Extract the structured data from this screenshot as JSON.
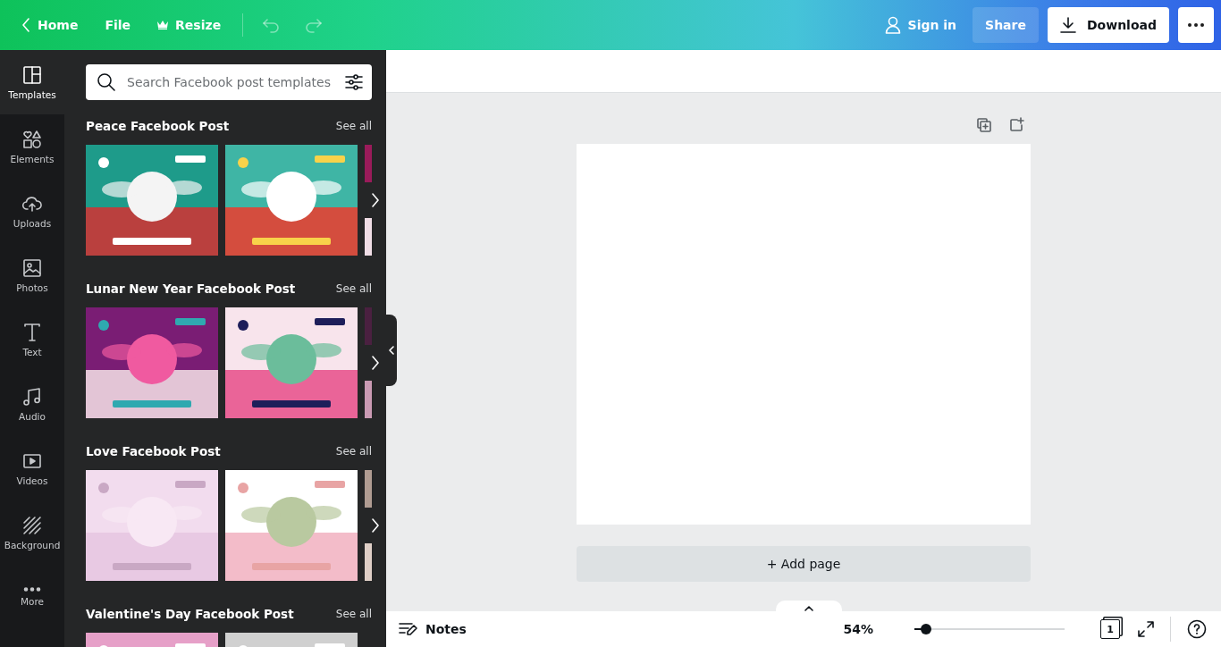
{
  "topbar": {
    "back": {
      "label": "Home"
    },
    "menu": [
      {
        "label": "File",
        "kind": "plain"
      },
      {
        "label": "Resize",
        "kind": "crown"
      }
    ],
    "undo": {
      "disabled": true
    },
    "redo": {
      "disabled": true
    },
    "sign_in": "Sign in",
    "share": "Share",
    "download": "Download"
  },
  "rail": [
    {
      "label": "Templates",
      "selected": true
    },
    {
      "label": "Elements",
      "selected": false
    },
    {
      "label": "Uploads",
      "selected": false
    },
    {
      "label": "Photos",
      "selected": false
    },
    {
      "label": "Text",
      "selected": false
    },
    {
      "label": "Audio",
      "selected": false
    },
    {
      "label": "Videos",
      "selected": false
    },
    {
      "label": "Background",
      "selected": false
    },
    {
      "label": "More",
      "selected": false
    }
  ],
  "panel": {
    "search": {
      "placeholder": "Search Facebook post templates"
    },
    "sections": [
      {
        "title": "Peace Facebook Post",
        "see_all": "See all"
      },
      {
        "title": "Lunar New Year Facebook Post",
        "see_all": "See all"
      },
      {
        "title": "Love Facebook Post",
        "see_all": "See all"
      },
      {
        "title": "Valentine's Day Facebook Post",
        "see_all": "See all"
      }
    ]
  },
  "canvas": {
    "add_page": "+ Add page"
  },
  "footer": {
    "notes": "Notes",
    "zoom": "54%",
    "zoom_slider": {
      "level": 0.08
    },
    "page_count": "1"
  }
}
